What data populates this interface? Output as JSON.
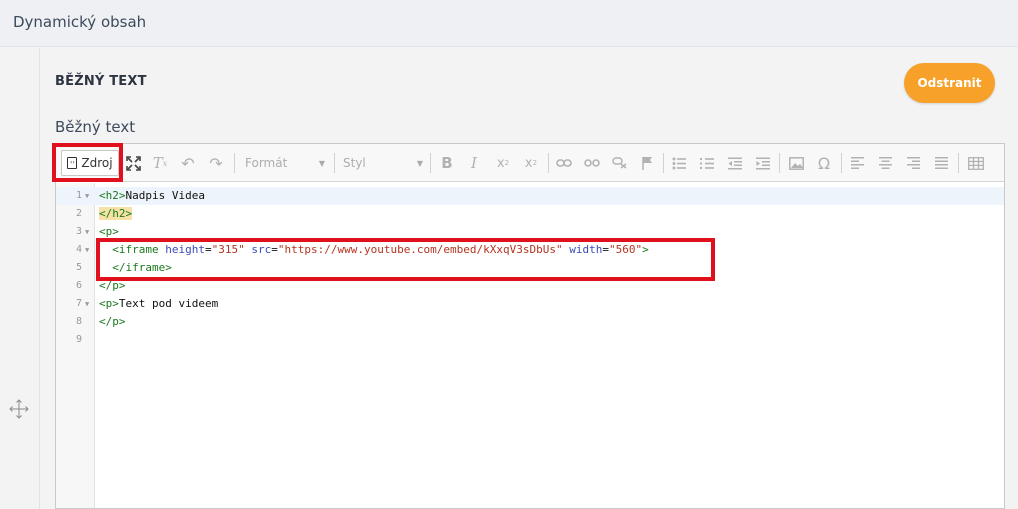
{
  "header": {
    "title": "Dynamický obsah"
  },
  "section": {
    "heading": "BĚŽNÝ TEXT",
    "remove_label": "Odstranit"
  },
  "field": {
    "label": "Běžný text"
  },
  "toolbar": {
    "source_label": "Zdroj",
    "format_placeholder": "Formát",
    "style_placeholder": "Styl",
    "icons": [
      "maximize-icon",
      "remove-format-icon",
      "undo-icon",
      "redo-icon",
      "bold-icon",
      "italic-icon",
      "subscript-icon",
      "superscript-icon",
      "link-icon",
      "unlink-icon",
      "anchor-icon",
      "flag-icon",
      "bulleted-list-icon",
      "numbered-list-icon",
      "outdent-icon",
      "indent-icon",
      "align-left-icon",
      "align-center-icon",
      "align-right-icon",
      "justify-icon",
      "image-icon",
      "special-char-icon",
      "table-icon"
    ]
  },
  "code": {
    "lines": [
      {
        "num": "1",
        "fold": true
      },
      {
        "num": "2",
        "fold": false
      },
      {
        "num": "3",
        "fold": true
      },
      {
        "num": "4",
        "fold": true
      },
      {
        "num": "5",
        "fold": false
      },
      {
        "num": "6",
        "fold": false
      },
      {
        "num": "7",
        "fold": true
      },
      {
        "num": "8",
        "fold": false
      },
      {
        "num": "9",
        "fold": false
      }
    ],
    "h2_open": "<h2>",
    "heading_text": "Nadpis Videa",
    "h2_close": "</h2>",
    "p_open": "<p>",
    "iframe_open": "<iframe",
    "attr_height": "height",
    "val_height": "\"315\"",
    "attr_src": "src",
    "val_src": "\"https://www.youtube.com/embed/kXxqV3sDbUs\"",
    "attr_width": "width",
    "val_width": "\"560\"",
    "gt": ">",
    "eq": "=",
    "iframe_close": "</iframe>",
    "p_close": "</p>",
    "paragraph_text": "Text pod videem"
  }
}
